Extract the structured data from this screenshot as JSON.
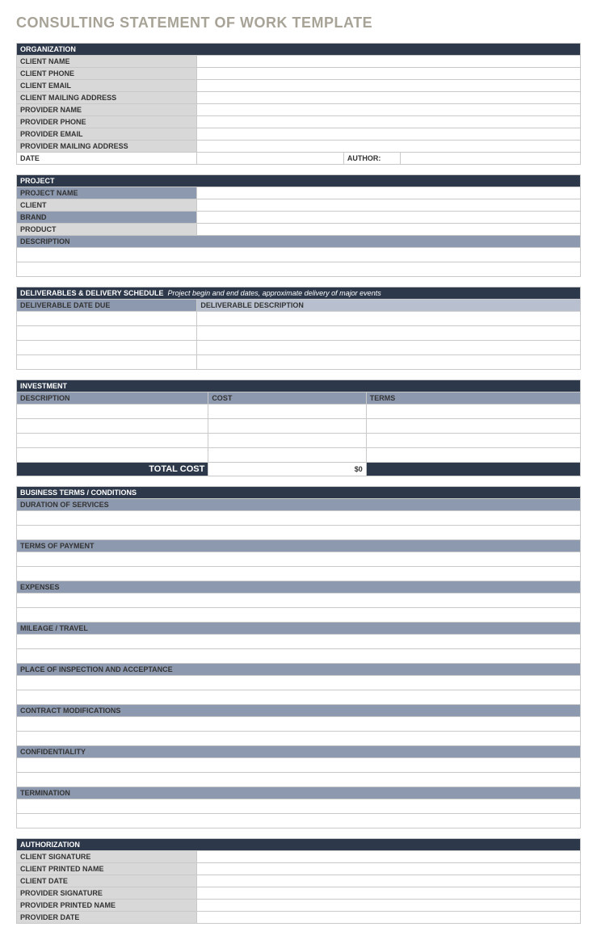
{
  "title": "CONSULTING STATEMENT OF WORK TEMPLATE",
  "organization": {
    "header": "ORGANIZATION",
    "rows": {
      "client_name": "CLIENT NAME",
      "client_phone": "CLIENT  PHONE",
      "client_email": "CLIENT EMAIL",
      "client_mailing": "CLIENT MAILING ADDRESS",
      "provider_name": "PROVIDER NAME",
      "provider_phone": "PROVIDER PHONE",
      "provider_email": "PROVIDER EMAIL",
      "provider_mailing": "PROVIDER MAILING ADDRESS"
    },
    "date": "DATE",
    "author": "AUTHOR:"
  },
  "project": {
    "header": "PROJECT",
    "rows": {
      "project_name": "PROJECT NAME",
      "client": "CLIENT",
      "brand": "BRAND",
      "product": "PRODUCT",
      "description": "DESCRIPTION"
    }
  },
  "deliverables": {
    "header": "DELIVERABLES & DELIVERY SCHEDULE",
    "subtitle": "Project begin and end dates, approximate delivery of major events",
    "col_date": "DELIVERABLE DATE DUE",
    "col_desc": "DELIVERABLE DESCRIPTION"
  },
  "investment": {
    "header": "INVESTMENT",
    "col_desc": "DESCRIPTION",
    "col_cost": "COST",
    "col_terms": "TERMS",
    "total_label": "TOTAL COST",
    "total_value": "$0"
  },
  "business_terms": {
    "header": "BUSINESS TERMS / CONDITIONS",
    "rows": {
      "duration": "DURATION OF SERVICES",
      "payment": "TERMS OF PAYMENT",
      "expenses": "EXPENSES",
      "mileage": "MILEAGE / TRAVEL",
      "inspection": "PLACE OF INSPECTION AND ACCEPTANCE",
      "modifications": "CONTRACT MODIFICATIONS",
      "confidentiality": "CONFIDENTIALITY",
      "termination": "TERMINATION"
    }
  },
  "authorization": {
    "header": "AUTHORIZATION",
    "rows": {
      "client_sig": "CLIENT SIGNATURE",
      "client_print": "CLIENT PRINTED NAME",
      "client_date": "CLIENT DATE",
      "provider_sig": "PROVIDER SIGNATURE",
      "provider_print": "PROVIDER PRINTED NAME",
      "provider_date": "PROVIDER DATE"
    }
  }
}
